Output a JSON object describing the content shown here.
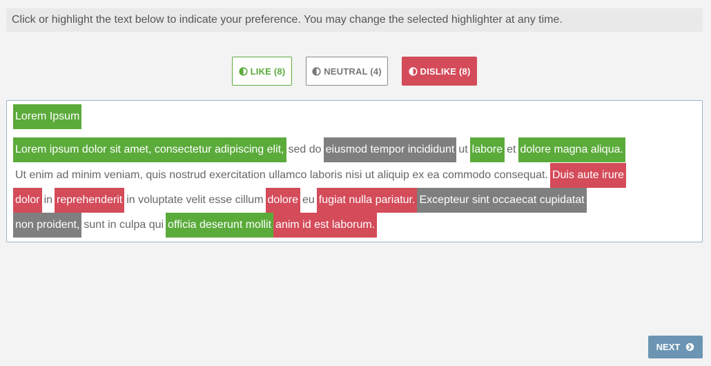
{
  "instructions": "Click or highlight the text below to indicate your preference. You may change the selected highlighter at any time.",
  "highlighters": {
    "like": {
      "label": "LIKE (8)",
      "icon": "half-circle-icon",
      "color": "#5bab3b"
    },
    "neutral": {
      "label": "NEUTRAL (4)",
      "icon": "half-circle-icon",
      "color": "#7f7f7f"
    },
    "dislike": {
      "label": "DISLIKE (8)",
      "icon": "half-circle-icon",
      "color": "#d44b59",
      "selected": true
    }
  },
  "passage": {
    "lines": [
      [
        {
          "text": "Lorem Ipsum",
          "tag": "like"
        }
      ],
      [
        {
          "text": "Lorem ipsum dolor sit amet, consectetur adipiscing elit,",
          "tag": "like"
        },
        {
          "text": "sed do",
          "tag": "none"
        },
        {
          "text": "eiusmod tempor incididunt",
          "tag": "neutral"
        },
        {
          "text": "ut",
          "tag": "none"
        },
        {
          "text": "labore",
          "tag": "like"
        },
        {
          "text": "et",
          "tag": "none"
        },
        {
          "text": "dolore magna aliqua.",
          "tag": "like"
        }
      ],
      [
        {
          "text": "Ut enim ad minim veniam, quis nostrud exercitation ullamco laboris nisi ut aliquip ex ea commodo consequat.",
          "tag": "none"
        },
        {
          "text": "Duis aute irure",
          "tag": "dislike"
        }
      ],
      [
        {
          "text": "dolor",
          "tag": "dislike"
        },
        {
          "text": "in",
          "tag": "none"
        },
        {
          "text": "reprehenderit",
          "tag": "dislike"
        },
        {
          "text": "in voluptate velit esse cillum",
          "tag": "none"
        },
        {
          "text": "dolore",
          "tag": "dislike"
        },
        {
          "text": "eu",
          "tag": "none"
        },
        {
          "text": "fugiat nulla pariatur.",
          "tag": "dislike"
        },
        {
          "text": "Excepteur sint occaecat cupidatat",
          "tag": "neutral"
        }
      ],
      [
        {
          "text": "non proident,",
          "tag": "neutral"
        },
        {
          "text": "sunt in culpa qui",
          "tag": "none"
        },
        {
          "text": "officia deserunt mollit",
          "tag": "like"
        },
        {
          "text": "anim id est laborum.",
          "tag": "dislike"
        }
      ]
    ]
  },
  "next": {
    "label": "NEXT",
    "icon": "arrow-circle-right-icon"
  }
}
